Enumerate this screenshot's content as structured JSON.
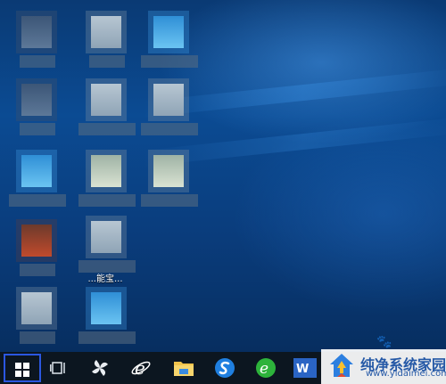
{
  "desktop": {
    "icons": [
      {
        "label": ""
      },
      {
        "label": ""
      },
      {
        "label": ""
      },
      {
        "label": ""
      },
      {
        "label": ""
      },
      {
        "label": ""
      },
      {
        "label": ""
      },
      {
        "label": ""
      },
      {
        "label": ""
      },
      {
        "label": ""
      },
      {
        "label": "...能宝..."
      },
      {
        "label": ""
      },
      {
        "label": ""
      }
    ]
  },
  "watermark": "🐾",
  "taskbar": {
    "items": [
      {
        "icon": "windows-start-icon"
      },
      {
        "icon": "task-view-icon"
      },
      {
        "icon": "pinwheel-app-icon"
      },
      {
        "icon": "internet-explorer-icon"
      },
      {
        "icon": "file-explorer-icon"
      },
      {
        "icon": "sogou-browser-icon"
      },
      {
        "icon": "360-browser-icon"
      },
      {
        "icon": "word-icon"
      }
    ]
  },
  "branding": {
    "title": "纯净系统家园",
    "url": "www.yidaimei.com"
  }
}
